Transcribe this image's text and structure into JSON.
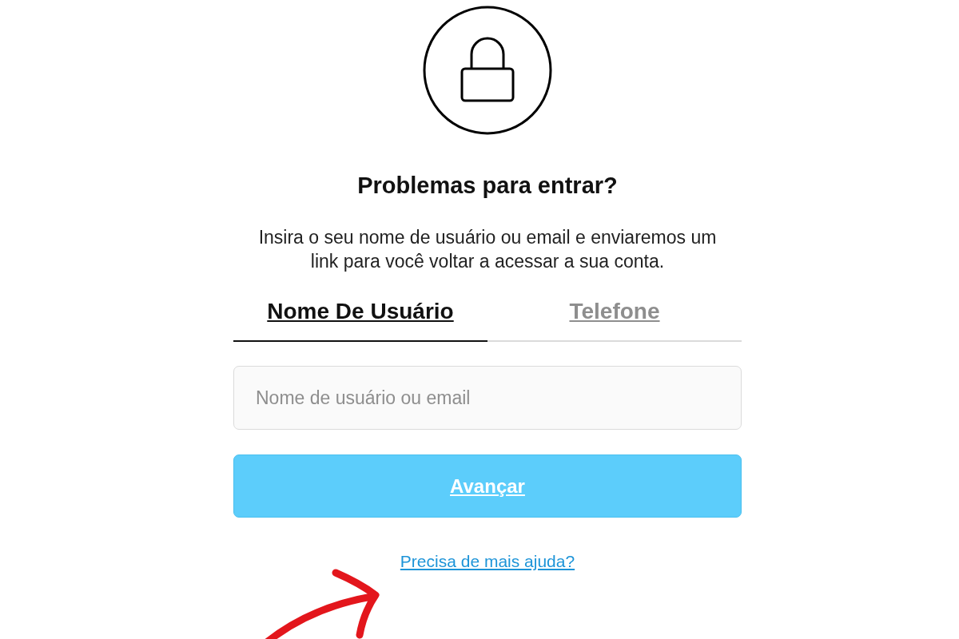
{
  "title": "Problemas para entrar?",
  "description": "Insira o seu nome de usuário ou email e enviaremos um link para você voltar a acessar a sua conta.",
  "tabs": [
    {
      "label": "Nome De Usuário",
      "selected": true
    },
    {
      "label": "Telefone",
      "selected": false
    }
  ],
  "username_field": {
    "placeholder": "Nome de usuário ou email"
  },
  "next_button": {
    "label": "Avançar"
  },
  "help_link": {
    "label": "Precisa de mais ajuda?"
  }
}
